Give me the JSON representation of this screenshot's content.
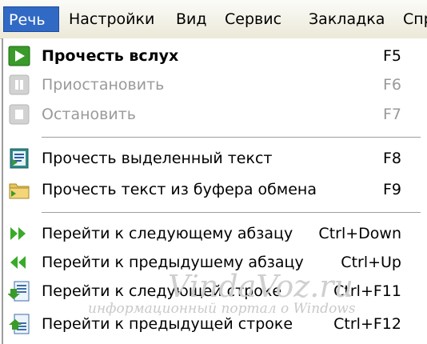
{
  "menubar": {
    "items": [
      {
        "label": "Речь",
        "active": true
      },
      {
        "label": "Настройки"
      },
      {
        "label": "Вид"
      },
      {
        "label": "Сервис"
      },
      {
        "label": "Закладка"
      },
      {
        "label": "Спр"
      }
    ]
  },
  "menu": {
    "items": [
      {
        "label": "Прочесть вслух",
        "shortcut": "F5",
        "icon": "play-icon",
        "bold": true,
        "enabled": true
      },
      {
        "label": "Приостановить",
        "shortcut": "F6",
        "icon": "pause-icon",
        "enabled": false
      },
      {
        "label": "Остановить",
        "shortcut": "F7",
        "icon": "stop-icon",
        "enabled": false
      },
      {
        "label": "Прочесть выделенный текст",
        "shortcut": "F8",
        "icon": "read-selection-icon",
        "enabled": true
      },
      {
        "label": "Прочесть текст из буфера обмена",
        "shortcut": "F9",
        "icon": "clipboard-folder-icon",
        "enabled": true
      },
      {
        "label": "Перейти к следующему абзацу",
        "shortcut": "Ctrl+Down",
        "icon": "next-paragraph-icon",
        "enabled": true
      },
      {
        "label": "Перейти к предыдушему абзацу",
        "shortcut": "Ctrl+Up",
        "icon": "previous-paragraph-icon",
        "enabled": true
      },
      {
        "label": "Перейти к следующей строке",
        "shortcut": "Ctrl+F11",
        "icon": "next-line-icon",
        "enabled": true
      },
      {
        "label": "Перейти к предыдущей строке",
        "shortcut": "Ctrl+F12",
        "icon": "previous-line-icon",
        "enabled": true
      }
    ]
  },
  "watermark": {
    "title": "VindaVoz.ru",
    "subtitle": "информационный портал о Windows"
  },
  "colors": {
    "menu_highlight": "#316ac5",
    "play_green": "#3a9a2a",
    "disabled_gray": "#9a9a9a"
  }
}
